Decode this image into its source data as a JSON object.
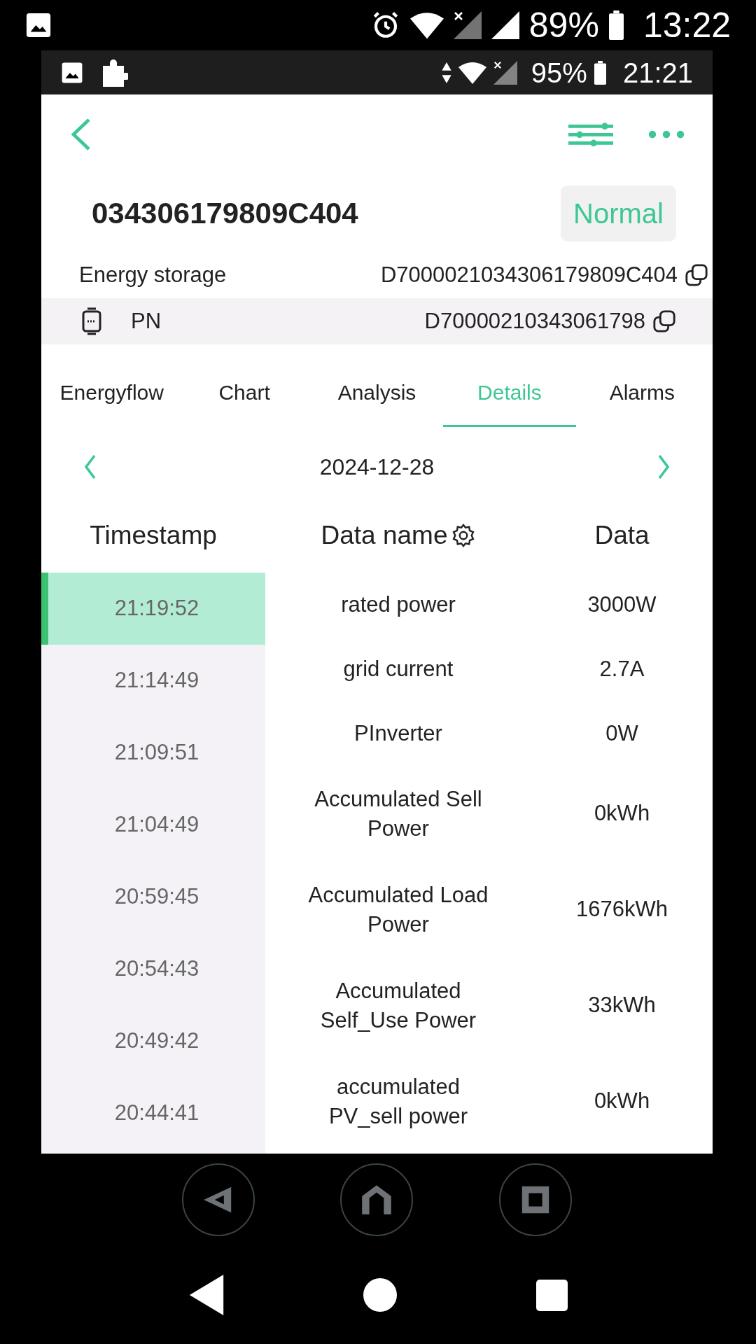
{
  "outer_status_bar": {
    "battery": "89%",
    "time": "13:22"
  },
  "inner_status_bar": {
    "battery": "95%",
    "time": "21:21"
  },
  "device": {
    "title": "034306179809C404",
    "status": "Normal",
    "rows": [
      {
        "kind": "plain",
        "label": "Energy storage",
        "value": "D7000021034306179809C404"
      },
      {
        "kind": "device",
        "label": "PN",
        "value": "D70000210343061798"
      }
    ]
  },
  "tabs": [
    {
      "label": "Energyflow",
      "selected": false
    },
    {
      "label": "Chart",
      "selected": false
    },
    {
      "label": "Analysis",
      "selected": false
    },
    {
      "label": "Details",
      "selected": true
    },
    {
      "label": "Alarms",
      "selected": false
    }
  ],
  "date": "2024-12-28",
  "table": {
    "columns": [
      "Timestamp",
      "Data name",
      "Data"
    ],
    "timestamps": [
      {
        "time": "21:19:52",
        "selected": true
      },
      {
        "time": "21:14:49",
        "selected": false
      },
      {
        "time": "21:09:51",
        "selected": false
      },
      {
        "time": "21:04:49",
        "selected": false
      },
      {
        "time": "20:59:45",
        "selected": false
      },
      {
        "time": "20:54:43",
        "selected": false
      },
      {
        "time": "20:49:42",
        "selected": false
      },
      {
        "time": "20:44:41",
        "selected": false
      }
    ],
    "rows": [
      {
        "name": "rated power",
        "value": "3000W"
      },
      {
        "name": "grid current",
        "value": "2.7A"
      },
      {
        "name": "PInverter",
        "value": "0W"
      },
      {
        "name": "Accumulated Sell Power",
        "value": "0kWh"
      },
      {
        "name": "Accumulated Load Power",
        "value": "1676kWh"
      },
      {
        "name": "Accumulated Self_Use Power",
        "value": "33kWh"
      },
      {
        "name": "accumulated PV_sell power",
        "value": "0kWh"
      }
    ]
  }
}
